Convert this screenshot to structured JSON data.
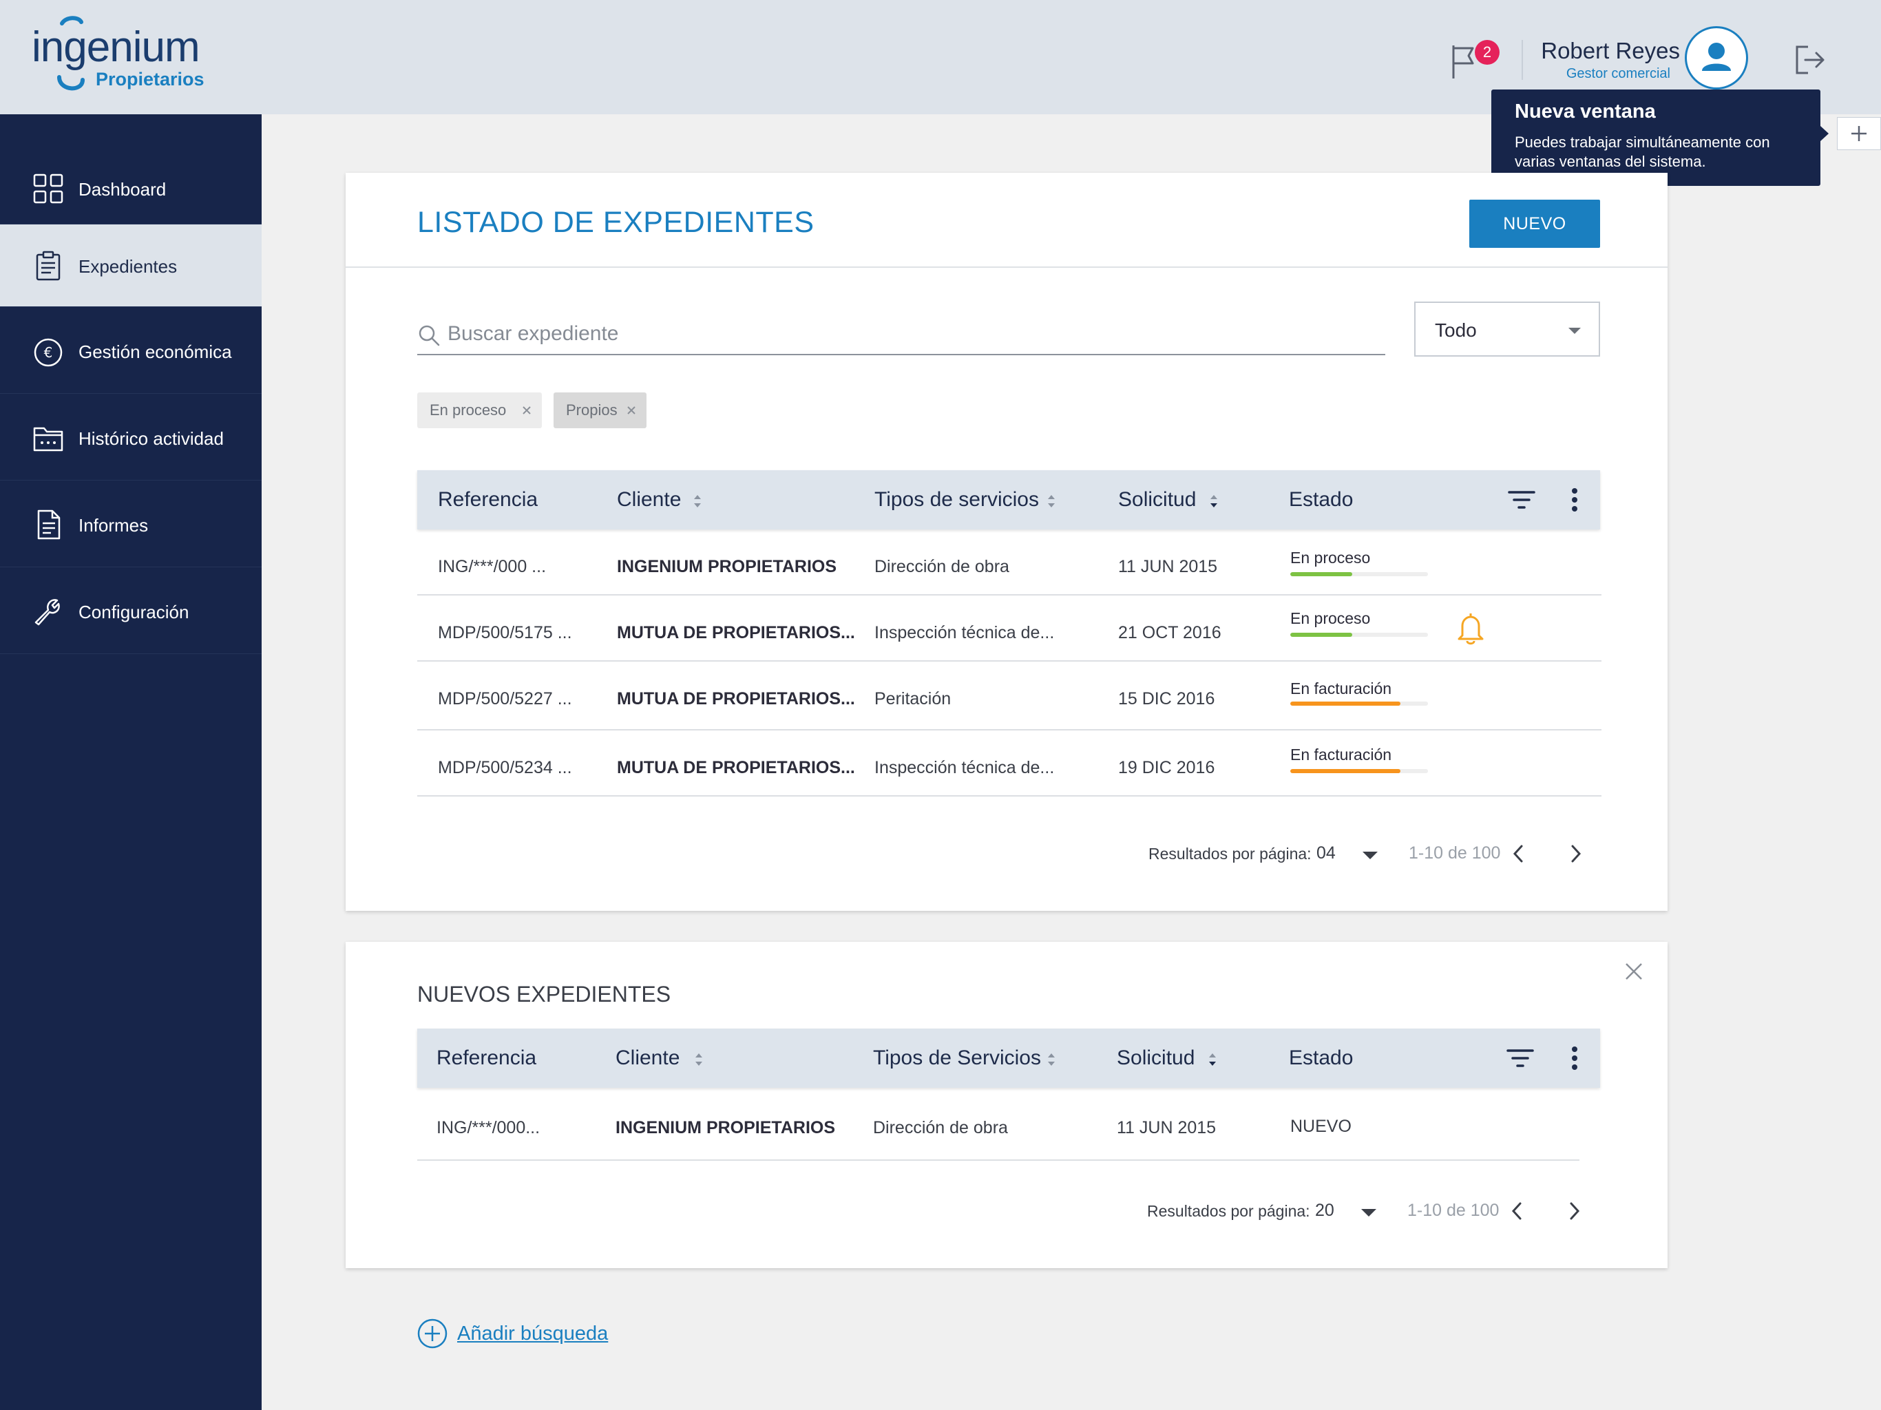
{
  "header": {
    "logo_text": "ingenium",
    "logo_sub": "Propietarios",
    "notifications_count": "2",
    "user_name": "Robert Reyes",
    "user_role": "Gestor comercial",
    "icons": [
      "flag-icon",
      "user-icon",
      "logout-icon",
      "plus-icon"
    ]
  },
  "tooltip": {
    "title": "Nueva ventana",
    "text": "Puedes trabajar simultáneamente con varias ventanas del sistema."
  },
  "sidebar": {
    "items": [
      {
        "label": "Dashboard",
        "icon": "grid-icon",
        "active": false
      },
      {
        "label": "Expedientes",
        "icon": "clipboard-icon",
        "active": true
      },
      {
        "label": "Gestión económica",
        "icon": "euro-icon",
        "active": false
      },
      {
        "label": "Histórico actividad",
        "icon": "folder-icon",
        "active": false
      },
      {
        "label": "Informes",
        "icon": "document-icon",
        "active": false
      },
      {
        "label": "Configuración",
        "icon": "wrench-icon",
        "active": false
      }
    ]
  },
  "listado": {
    "title": "LISTADO DE EXPEDIENTES",
    "new_button": "NUEVO",
    "search_placeholder": "Buscar expediente",
    "filter_select": "Todo",
    "chips": [
      "En proceso",
      "Propios"
    ],
    "columns": [
      "Referencia",
      "Cliente",
      "Tipos de servicios",
      "Solicitud",
      "Estado"
    ],
    "rows": [
      {
        "ref": "ING/***/000 ...",
        "client": "INGENIUM PROPIETARIOS",
        "service": "Dirección de obra",
        "date": "11 JUN 2015",
        "state": "En proceso",
        "progress": 0.45,
        "alert": false
      },
      {
        "ref": "MDP/500/5175 ...",
        "client": "MUTUA DE PROPIETARIOS...",
        "service": "Inspección técnica de...",
        "date": "21 OCT 2016",
        "state": "En proceso",
        "progress": 0.45,
        "alert": true
      },
      {
        "ref": "MDP/500/5227 ...",
        "client": "MUTUA DE PROPIETARIOS...",
        "service": "Peritación",
        "date": "15 DIC 2016",
        "state": "En facturación",
        "progress": 0.8,
        "alert": false
      },
      {
        "ref": "MDP/500/5234 ...",
        "client": "MUTUA DE PROPIETARIOS...",
        "service": "Inspección técnica de...",
        "date": "19 DIC 2016",
        "state": "En facturación",
        "progress": 0.8,
        "alert": false
      }
    ],
    "pager": {
      "label": "Resultados por página:",
      "per_page": "04",
      "range": "1-10 de 100"
    }
  },
  "nuevos": {
    "title": "NUEVOS EXPEDIENTES",
    "columns": [
      "Referencia",
      "Cliente",
      "Tipos de Servicios",
      "Solicitud",
      "Estado"
    ],
    "rows": [
      {
        "ref": "ING/***/000...",
        "client": "INGENIUM PROPIETARIOS",
        "service": "Dirección de obra",
        "date": "11 JUN 2015",
        "state": "NUEVO"
      }
    ],
    "pager": {
      "label": "Resultados por página:",
      "per_page": "20",
      "range": "1-10 de 100"
    }
  },
  "add_search": "Añadir búsqueda",
  "colors": {
    "navy": "#17254a",
    "brand_blue": "#1a7fc0",
    "progress_green": "#7dc243",
    "progress_orange": "#f7941d",
    "badge_red": "#e5225a",
    "alert_orange": "#f5a623"
  }
}
